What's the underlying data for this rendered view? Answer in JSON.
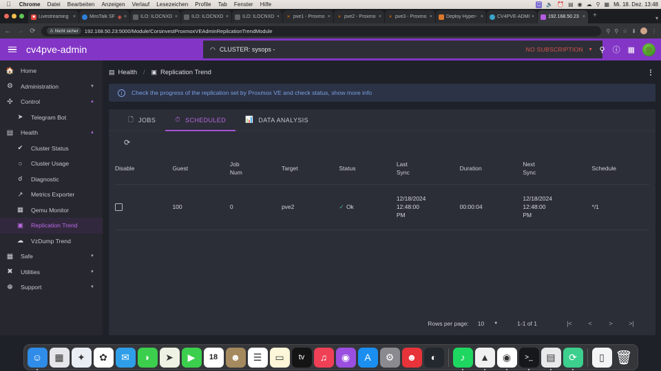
{
  "os_menubar": {
    "apple_icon": "apple-logo",
    "items": [
      "Chrome",
      "Datei",
      "Bearbeiten",
      "Anzeigen",
      "Verlauf",
      "Lesezeichen",
      "Profile",
      "Tab",
      "Fenster",
      "Hilfe"
    ],
    "status_icons": [
      "screen-mirroring-icon",
      "volume-icon",
      "time-machine-icon",
      "battery-icon",
      "control-center-icon",
      "wifi-icon",
      "search-icon",
      "display-icon"
    ],
    "clock": "Mi. 18. Dez.  13:48"
  },
  "browser": {
    "traffic_lights": [
      "close",
      "minimize",
      "zoom"
    ],
    "tabs": [
      {
        "title": "Livestreaming",
        "favicon_color": "#e8453c",
        "active": false
      },
      {
        "title": "MiroTalk SF",
        "favicon_color": "#2f7fd8",
        "active": false,
        "extra_icon": "record-icon"
      },
      {
        "title": "ILO: ILOCNXD",
        "favicon_color": "#5f6368",
        "active": false
      },
      {
        "title": "ILO: ILOCNXD",
        "favicon_color": "#5f6368",
        "active": false
      },
      {
        "title": "ILO: ILOCNXD",
        "favicon_color": "#5f6368",
        "active": false
      },
      {
        "title": "pve1 - Proxmo",
        "favicon_color": "#e57000",
        "active": false
      },
      {
        "title": "pve2 - Proxmo",
        "favicon_color": "#e57000",
        "active": false
      },
      {
        "title": "pve3 - Proxmo",
        "favicon_color": "#e57000",
        "active": false
      },
      {
        "title": "Deploy Hyper-",
        "favicon_color": "#d9772b",
        "active": false
      },
      {
        "title": "CV4PVE-ADMI",
        "favicon_color": "#3aa3c9",
        "active": false
      },
      {
        "title": "192.168.50.23",
        "favicon_color": "#b35ce0",
        "active": true
      }
    ],
    "new_tab_label": "+",
    "tab_list_chevron": "chevron-down-icon",
    "nav": {
      "back": "←",
      "forward": "→",
      "reload": "⟳"
    },
    "security_label": "Nicht sicher",
    "url": "192.168.50.23:5000/Module/CorsinvestProxmoxVEAdminReplicationTrendModule",
    "omnibox_icons": [
      "password-key-icon",
      "zoom-icon",
      "bookmark-star-icon",
      "download-icon",
      "profile-avatar-icon",
      "chrome-menu-icon"
    ]
  },
  "appbar": {
    "menu_icon": "hamburger-menu-icon",
    "brand": "cv4pve-admin",
    "cluster_icon": "external-link-icon",
    "cluster_label": "CLUSTER: sysops -",
    "subscription_label": "NO SUBSCRIPTION",
    "subscription_caret": "chevron-down-icon",
    "subscription_color": "#d9534f",
    "right_icons": [
      "search-icon",
      "help-icon",
      "apps-grid-icon",
      "avatar"
    ],
    "accent_color": "#8336c6"
  },
  "sidebar": {
    "items": [
      {
        "label": "Home",
        "icon": "home-icon",
        "level": 0,
        "expandable": false,
        "active": false
      },
      {
        "label": "Administration",
        "icon": "administration-icon",
        "level": 0,
        "expandable": true,
        "expanded": false,
        "active": false
      },
      {
        "label": "Control",
        "icon": "control-icon",
        "level": 0,
        "expandable": true,
        "expanded": true,
        "active": false
      },
      {
        "label": "Telegram Bot",
        "icon": "telegram-icon",
        "level": 1,
        "expandable": false,
        "active": false
      },
      {
        "label": "Health",
        "icon": "health-icon",
        "level": 0,
        "expandable": true,
        "expanded": true,
        "active": false
      },
      {
        "label": "Cluster Status",
        "icon": "check-badge-icon",
        "level": 1,
        "expandable": false,
        "active": false
      },
      {
        "label": "Cluster Usage",
        "icon": "gauge-icon",
        "level": 1,
        "expandable": false,
        "active": false
      },
      {
        "label": "Diagnostic",
        "icon": "stethoscope-icon",
        "level": 1,
        "expandable": false,
        "active": false
      },
      {
        "label": "Metrics Exporter",
        "icon": "trend-line-icon",
        "level": 1,
        "expandable": false,
        "active": false
      },
      {
        "label": "Qemu Monitor",
        "icon": "monitor-icon",
        "level": 1,
        "expandable": false,
        "active": false
      },
      {
        "label": "Replication Trend",
        "icon": "replication-icon",
        "level": 1,
        "expandable": false,
        "active": true
      },
      {
        "label": "VzDump Trend",
        "icon": "cloud-upload-icon",
        "level": 1,
        "expandable": false,
        "active": false
      },
      {
        "label": "Safe",
        "icon": "safe-icon",
        "level": 0,
        "expandable": true,
        "expanded": false,
        "active": false
      },
      {
        "label": "Utilities",
        "icon": "tools-icon",
        "level": 0,
        "expandable": true,
        "expanded": false,
        "active": false
      },
      {
        "label": "Support",
        "icon": "lifebuoy-icon",
        "level": 0,
        "expandable": true,
        "expanded": false,
        "active": false
      }
    ],
    "active_color": "#b86ae0"
  },
  "breadcrumb": {
    "parent": "Health",
    "parent_icon": "health-icon",
    "separator": "/",
    "current": "Replication Trend",
    "current_icon": "replication-icon",
    "kebab": "more-options-icon"
  },
  "info_banner": {
    "icon": "info-icon",
    "text": "Check the progress of the replication set by Proxmox VE and check status, show more info",
    "text_color": "#7b9fe3",
    "background": "#2c3346"
  },
  "tabs": [
    {
      "label": "JOBS",
      "icon": "jobs-document-icon",
      "active": false
    },
    {
      "label": "SCHEDULED",
      "icon": "clock-icon",
      "active": true
    },
    {
      "label": "DATA ANALYSIS",
      "icon": "bar-chart-icon",
      "active": false
    }
  ],
  "toolbar": {
    "refresh_icon": "refresh-icon"
  },
  "table": {
    "columns": [
      "Disable",
      "Guest",
      "Job Num",
      "Target",
      "Status",
      "Last Sync",
      "Duration",
      "Next Sync",
      "Schedule"
    ],
    "rows": [
      {
        "disable_checked": false,
        "guest": "100",
        "job_num": "0",
        "target": "pve2",
        "status": "Ok",
        "status_icon": "check-icon",
        "status_color": "#4caf82",
        "last_sync": "12/18/2024 12:48:00 PM",
        "duration": "00:00:04",
        "next_sync": "12/18/2024 12:48:00 PM",
        "schedule": "*/1"
      }
    ]
  },
  "paginator": {
    "rows_per_page_label": "Rows per page:",
    "rows_per_page_value": "10",
    "select_caret": "chevron-down-icon",
    "range_label": "1-1 of 1",
    "first_page_icon": "|<",
    "prev_page_icon": "<",
    "next_page_icon": ">",
    "last_page_icon": ">|"
  },
  "dock": {
    "items": [
      {
        "name": "finder",
        "glyph": "☺",
        "bg": "#2f8ce8",
        "running": true
      },
      {
        "name": "launchpad",
        "glyph": "▦",
        "bg": "#e6e6ea",
        "running": false
      },
      {
        "name": "safari",
        "glyph": "✦",
        "bg": "#e9eef4",
        "running": false
      },
      {
        "name": "photos",
        "glyph": "✿",
        "bg": "#ffffff",
        "running": false
      },
      {
        "name": "mail",
        "glyph": "✉",
        "bg": "#2f9ee8",
        "running": false
      },
      {
        "name": "messages",
        "glyph": "◗",
        "bg": "#3ccf4e",
        "running": false
      },
      {
        "name": "maps",
        "glyph": "➤",
        "bg": "#eef2e4",
        "running": false
      },
      {
        "name": "facetime",
        "glyph": "▶",
        "bg": "#3ccf4e",
        "running": false
      },
      {
        "name": "calendar",
        "glyph": "18",
        "bg": "#ffffff",
        "running": false
      },
      {
        "name": "contacts",
        "glyph": "☻",
        "bg": "#a58a5f",
        "running": false
      },
      {
        "name": "reminders",
        "glyph": "☰",
        "bg": "#ffffff",
        "running": false
      },
      {
        "name": "notes",
        "glyph": "▭",
        "bg": "#fdf6d8",
        "running": false
      },
      {
        "name": "apple-tv",
        "glyph": "tv",
        "bg": "#141414",
        "running": false
      },
      {
        "name": "music",
        "glyph": "♫",
        "bg": "#ef4056",
        "running": false
      },
      {
        "name": "podcasts",
        "glyph": "◉",
        "bg": "#9b4fe0",
        "running": false
      },
      {
        "name": "app-store",
        "glyph": "A",
        "bg": "#1a8ff0",
        "running": false
      },
      {
        "name": "system-settings",
        "glyph": "⚙",
        "bg": "#8a8a90",
        "running": false
      },
      {
        "name": "anydesk",
        "glyph": "☻",
        "bg": "#e8333a",
        "running": false
      },
      {
        "name": "quicklook",
        "glyph": "◐",
        "bg": "#23272e",
        "running": false
      },
      {
        "name": "spotify",
        "glyph": "♪",
        "bg": "#1ed760",
        "running": true
      },
      {
        "name": "vlc",
        "glyph": "▲",
        "bg": "#f0f0f0",
        "running": true
      },
      {
        "name": "chrome",
        "glyph": "◉",
        "bg": "#ffffff",
        "running": true
      },
      {
        "name": "terminal",
        "glyph": ">_",
        "bg": "#17181b",
        "running": true
      },
      {
        "name": "calculator",
        "glyph": "▤",
        "bg": "#e9e9ec",
        "running": true
      },
      {
        "name": "sync-app",
        "glyph": "⟳",
        "bg": "#3ccf8e",
        "running": true
      },
      {
        "name": "document",
        "glyph": "▯",
        "bg": "#f4f4f6",
        "running": false
      },
      {
        "name": "trash",
        "glyph": "🗑",
        "bg": "transparent",
        "running": false
      }
    ]
  }
}
